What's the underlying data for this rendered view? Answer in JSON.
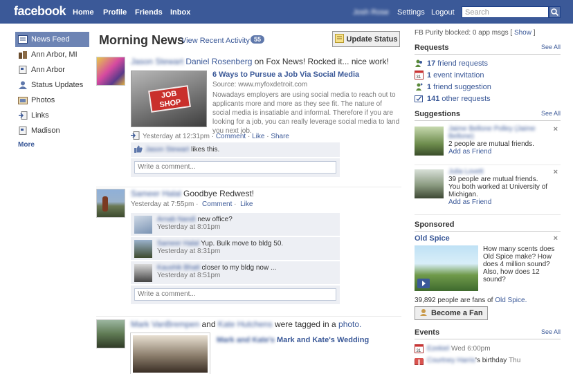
{
  "topbar": {
    "logo": "facebook",
    "nav": [
      "Home",
      "Profile",
      "Friends",
      "Inbox"
    ],
    "user_name": "Josh Rose",
    "settings": "Settings",
    "logout": "Logout",
    "search_placeholder": "Search"
  },
  "leftnav": {
    "items": [
      {
        "label": "News Feed",
        "icon": "news-feed-icon"
      },
      {
        "label": "Ann Arbor, MI",
        "icon": "network-icon"
      },
      {
        "label": "Ann Arbor",
        "icon": "page-icon"
      },
      {
        "label": "Status Updates",
        "icon": "user-icon"
      },
      {
        "label": "Photos",
        "icon": "photos-icon"
      },
      {
        "label": "Links",
        "icon": "links-icon"
      },
      {
        "label": "Madison",
        "icon": "page-icon"
      }
    ],
    "more": "More"
  },
  "feed": {
    "title": "Morning News",
    "view_recent": "View Recent Activity",
    "recent_count": "55",
    "update_status": "Update Status",
    "stories": [
      {
        "author": "Jason Stewart",
        "text_a": "Daniel Rosenberg",
        "text_b": "on Fox News! Rocked it... nice work!",
        "link_title": "6 Ways to Pursue a Job Via Social Media",
        "source": "Source: www.myfoxdetroit.com",
        "description": "Nowadays employers are using social media to reach out to applicants more and more as they see fit. The nature of social media is insatiable and informal. Therefore if you are looking for a job, you can really leverage social media to land you next job.",
        "thumb_text": "JOB SHOP",
        "time": "Yesterday at 12:31pm",
        "comment": "Comment",
        "like": "Like",
        "share": "Share",
        "liker": "Jason Stewart",
        "likes_text": "likes this.",
        "write_comment": "Write a comment..."
      },
      {
        "author": "Sameer Halal",
        "text": "Goodbye Redwest!",
        "time": "Yesterday at 7:55pm",
        "comment": "Comment",
        "like": "Like",
        "comments": [
          {
            "name": "Arnab Nandi",
            "text": "new office?",
            "time": "Yesterday at 8:01pm"
          },
          {
            "name": "Sameer Halal",
            "text": "Yup. Bulk move to bldg 50.",
            "time": "Yesterday at 8:31pm"
          },
          {
            "name": "Kaushik Bhatt",
            "text": "closer to my bldg now ...",
            "time": "Yesterday at 8:51pm"
          }
        ],
        "write_comment": "Write a comment..."
      },
      {
        "name_a": "Mark VanBrempen",
        "and": "and",
        "name_b": "Kate Hutchens",
        "tagged": "were tagged in a",
        "photo": "photo.",
        "album": "Mark and Kate's Wedding"
      }
    ]
  },
  "rightcol": {
    "fbpurity": "FB Purity blocked: 0 app msgs [",
    "fbpurity_show": "Show",
    "fbpurity_end": "]",
    "requests_title": "Requests",
    "see_all": "See All",
    "requests": [
      {
        "count": "17",
        "label": "friend requests",
        "icon": "friends-icon"
      },
      {
        "count": "1",
        "label": "event invitation",
        "icon": "calendar-icon"
      },
      {
        "count": "1",
        "label": "friend suggestion",
        "icon": "suggestion-icon"
      },
      {
        "count": "141",
        "label": "other requests",
        "icon": "request-icon"
      }
    ],
    "suggestions_title": "Suggestions",
    "suggestions": [
      {
        "name": "Jaime Bellone Polley (Jaime Bellone)",
        "info": "2 people are mutual friends.",
        "add": "Add as Friend"
      },
      {
        "name": "Julia Lovett",
        "info": "39 people are mutual friends. You both worked at University of Michigan.",
        "add": "Add as Friend"
      }
    ],
    "sponsored_title": "Sponsored",
    "ad_title": "Old Spice",
    "ad_text": "How many scents does Old Spice make? How does 4 million sound? Also, how does 12 sound?",
    "ad_fans_a": "39,892 people are fans of",
    "ad_fans_link": "Old Spice.",
    "become_fan": "Become a Fan",
    "events_title": "Events",
    "events": [
      {
        "name": "Ezekiel",
        "time": "Wed 6:00pm"
      },
      {
        "name": "Courtney Harris",
        "suffix": "'s birthday",
        "time": "Thu"
      }
    ]
  }
}
